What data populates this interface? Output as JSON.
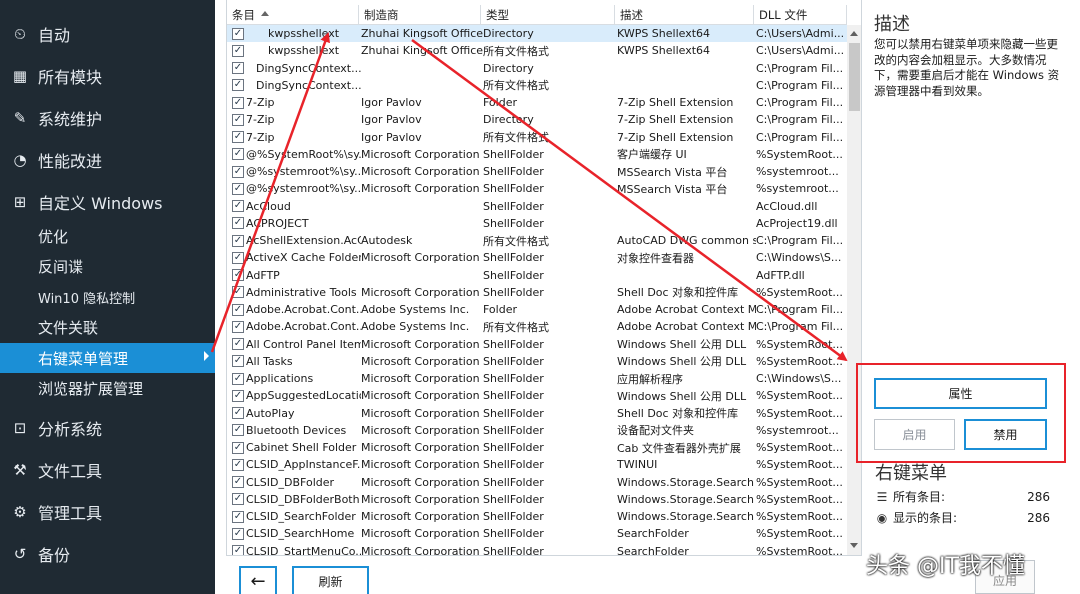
{
  "sidebar": {
    "items": [
      {
        "label": "自动",
        "icon": "clock-icon",
        "glyph": "⏲"
      },
      {
        "label": "所有模块",
        "icon": "grid-icon",
        "glyph": "▦"
      },
      {
        "label": "系统维护",
        "icon": "broom-icon",
        "glyph": "✎"
      },
      {
        "label": "性能改进",
        "icon": "gauge-icon",
        "glyph": "◔"
      },
      {
        "label": "自定义 Windows",
        "icon": "windows-icon",
        "glyph": "⊞"
      },
      {
        "label": "优化",
        "sub": true
      },
      {
        "label": "反间谍",
        "sub": true
      },
      {
        "label": "Win10 隐私控制",
        "sub": true,
        "small": true
      },
      {
        "label": "文件关联",
        "sub": true
      },
      {
        "label": "右键菜单管理",
        "sub": true,
        "active": true
      },
      {
        "label": "浏览器扩展管理",
        "sub": true
      },
      {
        "label": "分析系统",
        "icon": "analyze-icon",
        "glyph": "⊡"
      },
      {
        "label": "文件工具",
        "icon": "tools-icon",
        "glyph": "⚒"
      },
      {
        "label": "管理工具",
        "icon": "gear-icon",
        "glyph": "⚙"
      },
      {
        "label": "备份",
        "icon": "backup-icon",
        "glyph": "↺"
      }
    ]
  },
  "table": {
    "columns": [
      "条目",
      "制造商",
      "类型",
      "描述",
      "DLL 文件"
    ],
    "rows": [
      [
        "kwpsshellext",
        "Zhuhai Kingsoft Office ...",
        "Directory",
        "KWPS Shellext64",
        "C:\\Users\\Admi..."
      ],
      [
        "kwpsshellext",
        "Zhuhai Kingsoft Office ...",
        "所有文件格式",
        "KWPS Shellext64",
        "C:\\Users\\Admi..."
      ],
      [
        "DingSyncContext...",
        "",
        "Directory",
        "",
        "C:\\Program Fil..."
      ],
      [
        "DingSyncContext...",
        "",
        "所有文件格式",
        "",
        "C:\\Program Fil..."
      ],
      [
        "7-Zip",
        "Igor Pavlov",
        "Folder",
        "7-Zip Shell Extension",
        "C:\\Program Fil..."
      ],
      [
        "7-Zip",
        "Igor Pavlov",
        "Directory",
        "7-Zip Shell Extension",
        "C:\\Program Fil..."
      ],
      [
        "7-Zip",
        "Igor Pavlov",
        "所有文件格式",
        "7-Zip Shell Extension",
        "C:\\Program Fil..."
      ],
      [
        "@%SystemRoot%\\sy...",
        "Microsoft Corporation",
        "ShellFolder",
        "客户端缓存 UI",
        "%SystemRoot..."
      ],
      [
        "@%systemroot%\\sy...",
        "Microsoft Corporation",
        "ShellFolder",
        "MSSearch Vista 平台",
        "%systemroot..."
      ],
      [
        "@%systemroot%\\sy...",
        "Microsoft Corporation",
        "ShellFolder",
        "MSSearch Vista 平台",
        "%systemroot..."
      ],
      [
        "AcCloud",
        "",
        "ShellFolder",
        "",
        "AcCloud.dll"
      ],
      [
        "ACPROJECT",
        "",
        "ShellFolder",
        "",
        "AcProject19.dll"
      ],
      [
        "AcShellExtension.AcC...",
        "Autodesk",
        "所有文件格式",
        "AutoCAD DWG common sh...",
        "C:\\Program Fil..."
      ],
      [
        "ActiveX Cache Folder",
        "Microsoft Corporation",
        "ShellFolder",
        "对象控件查看器",
        "C:\\Windows\\S..."
      ],
      [
        "AdFTP",
        "",
        "ShellFolder",
        "",
        "AdFTP.dll"
      ],
      [
        "Administrative Tools",
        "Microsoft Corporation",
        "ShellFolder",
        "Shell Doc 对象和控件库",
        "%SystemRoot..."
      ],
      [
        "Adobe.Acrobat.Cont...",
        "Adobe Systems Inc.",
        "Folder",
        "Adobe Acrobat Context M...",
        "C:\\Program Fil..."
      ],
      [
        "Adobe.Acrobat.Cont...",
        "Adobe Systems Inc.",
        "所有文件格式",
        "Adobe Acrobat Context M...",
        "C:\\Program Fil..."
      ],
      [
        "All Control Panel Items",
        "Microsoft Corporation",
        "ShellFolder",
        "Windows Shell 公用 DLL",
        "%SystemRoot..."
      ],
      [
        "All Tasks",
        "Microsoft Corporation",
        "ShellFolder",
        "Windows Shell 公用 DLL",
        "%SystemRoot..."
      ],
      [
        "Applications",
        "Microsoft Corporation",
        "ShellFolder",
        "应用解析程序",
        "C:\\Windows\\S..."
      ],
      [
        "AppSuggestedLocations",
        "Microsoft Corporation",
        "ShellFolder",
        "Windows Shell 公用 DLL",
        "%SystemRoot..."
      ],
      [
        "AutoPlay",
        "Microsoft Corporation",
        "ShellFolder",
        "Shell Doc 对象和控件库",
        "%SystemRoot..."
      ],
      [
        "Bluetooth Devices",
        "Microsoft Corporation",
        "ShellFolder",
        "设备配对文件夹",
        "%systemroot..."
      ],
      [
        "Cabinet Shell Folder",
        "Microsoft Corporation",
        "ShellFolder",
        "Cab 文件查看器外壳扩展",
        "%SystemRoot..."
      ],
      [
        "CLSID_AppInstanceF...",
        "Microsoft Corporation",
        "ShellFolder",
        "TWINUI",
        "%SystemRoot..."
      ],
      [
        "CLSID_DBFolder",
        "Microsoft Corporation",
        "ShellFolder",
        "Windows.Storage.Search",
        "%SystemRoot..."
      ],
      [
        "CLSID_DBFolderBoth",
        "Microsoft Corporation",
        "ShellFolder",
        "Windows.Storage.Search",
        "%SystemRoot..."
      ],
      [
        "CLSID_SearchFolder",
        "Microsoft Corporation",
        "ShellFolder",
        "Windows.Storage.Search",
        "%SystemRoot..."
      ],
      [
        "CLSID_SearchHome",
        "Microsoft Corporation",
        "ShellFolder",
        "SearchFolder",
        "%SystemRoot..."
      ],
      [
        "CLSID_StartMenuCo...",
        "Microsoft Corporation",
        "ShellFolder",
        "SearchFolder",
        "%SystemRoot..."
      ]
    ],
    "check_mark": "✓"
  },
  "bottom": {
    "back_glyph": "←",
    "refresh_label": "刷新"
  },
  "panel": {
    "desc_title": "描述",
    "desc_text": "您可以禁用右键菜单项来隐藏一些更改的内容会加粗显示。大多数情况下，需要重启后才能在 Windows 资源管理器中看到效果。",
    "properties_label": "属性",
    "enable_label": "启用",
    "disable_label": "禁用",
    "ctx_title": "右键菜单",
    "stats": [
      {
        "label": "所有条目:",
        "value": "286",
        "glyph": "☰",
        "icon": "list-icon"
      },
      {
        "label": "显示的条目:",
        "value": "286",
        "glyph": "◉",
        "icon": "eye-icon"
      }
    ],
    "apply_label": "应用"
  },
  "watermark": "头条 @IT我不懂",
  "colors": {
    "sidebar_bg": "#1f2a33",
    "accent": "#1b8fd6",
    "annotation": "#e8232a"
  }
}
